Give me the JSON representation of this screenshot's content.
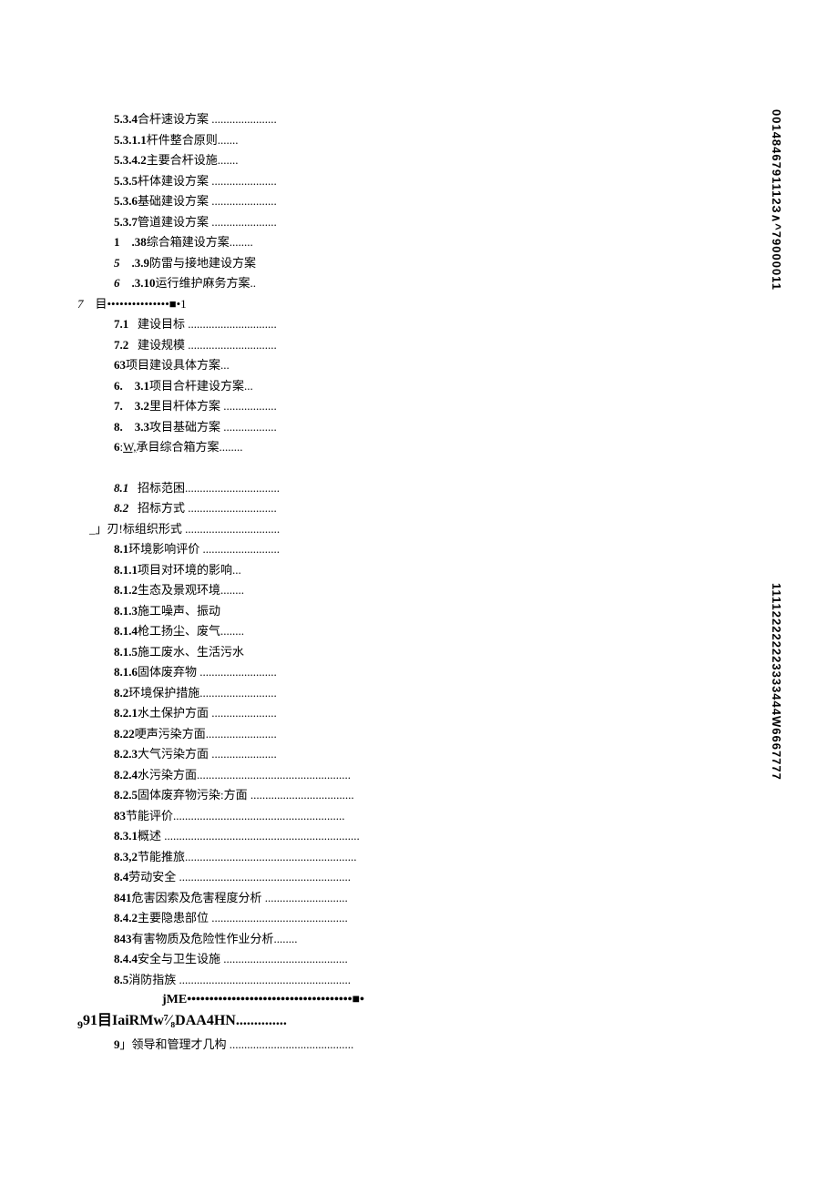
{
  "side": {
    "top": "0014846791112З∧^79000011",
    "bottom": "111122222223333444W6667777"
  },
  "lines": [
    {
      "cls": "indent1",
      "html": "<span class='bold-num'>5.3.4</span>合杆速设方案 ......................"
    },
    {
      "cls": "indent1",
      "html": "<span class='bold-num'>5.3.1.1</span>杆件整合原则......."
    },
    {
      "cls": "indent1",
      "html": "<span class='bold-num'>5.3.4.2</span>主要合杆设施......."
    },
    {
      "cls": "indent1",
      "html": "<span class='bold-num'>5.3.5</span>杆体建设方案 ......................"
    },
    {
      "cls": "indent1",
      "html": "<span class='bold-num'>5.3.6</span>基础建设方案 ......................"
    },
    {
      "cls": "indent1",
      "html": "<span class='bold-num'>5.3.7</span>管道建设方案 ......................"
    },
    {
      "cls": "indent1",
      "html": "<span class='bold-num'>1&nbsp;&nbsp;&nbsp;&nbsp;.38</span>综合箱建设方案........"
    },
    {
      "cls": "indent1",
      "html": "<span class='ital bold-num'>5&nbsp;&nbsp;&nbsp;&nbsp;</span><span class='bold-num'>.3.9</span>防雷与接地建设方案"
    },
    {
      "cls": "indent1",
      "html": "<span class='ital bold-num'>6&nbsp;&nbsp;&nbsp;&nbsp;</span><span class='bold-num'>.3.10</span>运行维护麻务方案.."
    },
    {
      "cls": "lvl7",
      "html": "<span class='ital'>7</span>&nbsp;&nbsp;&nbsp;&nbsp;目•••••••••••••••■•1"
    },
    {
      "cls": "indent1",
      "html": "<span class='bold-num'>7.1</span>&nbsp;&nbsp;&nbsp;建设目标 .............................."
    },
    {
      "cls": "indent1",
      "html": "<span class='bold-num'>7.2</span>&nbsp;&nbsp;&nbsp;建设规模 .............................."
    },
    {
      "cls": "indent1",
      "html": "<span class='bold-num'>63</span>项目建设具体方案..."
    },
    {
      "cls": "indent1",
      "html": "<span class='bold-num'>6.&nbsp;&nbsp;&nbsp;&nbsp;3.1</span>项目合杆建设方案..."
    },
    {
      "cls": "indent1",
      "html": "<span class='bold-num'>7.&nbsp;&nbsp;&nbsp;&nbsp;3.2</span>里目杆体方案 .................."
    },
    {
      "cls": "indent1",
      "html": "<span class='bold-num'>8.&nbsp;&nbsp;&nbsp;&nbsp;3.3</span>攻目基础方案 .................."
    },
    {
      "cls": "indent1",
      "html": "<span class='bold-num'>6</span>:<span class='underline'>W,</span>承目综合箱方案........"
    },
    {
      "cls": "gap",
      "html": ""
    },
    {
      "cls": "indent1",
      "html": "<span class='ital bold-num'>8.1</span>&nbsp;&nbsp;&nbsp;招标范困................................"
    },
    {
      "cls": "indent1",
      "html": "<span class='ital bold-num'>8.2</span>&nbsp;&nbsp;&nbsp;招标方式 .............................."
    },
    {
      "cls": "indent0",
      "html": "<span style='position:relative'>&nbsp;&nbsp;&nbsp;&nbsp;_」刃!标组织形式 ................................<span class='sec8' style='top:16px;left:0'>8</span></span>"
    },
    {
      "cls": "indent1",
      "html": "<span class='bold-num'>8.1</span>环境影响评价 .........................."
    },
    {
      "cls": "indent1",
      "html": "<span class='bold-num'>8.1.1</span>项目对环境的影响..."
    },
    {
      "cls": "indent1",
      "html": "<span class='bold-num'>8.1.2</span>生态及景观环境........"
    },
    {
      "cls": "indent1",
      "html": "<span class='bold-num'>8.1.3</span>施工噪声、振动"
    },
    {
      "cls": "indent1",
      "html": "<span class='bold-num'>8.1.4</span>枪工扬尘、废气........"
    },
    {
      "cls": "indent1",
      "html": "<span class='bold-num'>8.1.5</span>施工废水、生活污水"
    },
    {
      "cls": "indent1",
      "html": "<span class='bold-num'>8.1.6</span>固体废弃物 .........................."
    },
    {
      "cls": "indent1",
      "html": "<span class='bold-num'>8.2</span>环境保护措施.........................."
    },
    {
      "cls": "indent1",
      "html": "<span class='bold-num'>8.2.1</span>水土保护方面 ......................"
    },
    {
      "cls": "indent1",
      "html": "<span class='bold-num'>8.22</span>哽声污染方面........................"
    },
    {
      "cls": "indent1",
      "html": "<span class='bold-num'>8.2.3</span>大气污染方面 ......................"
    },
    {
      "cls": "indent1",
      "html": "<span class='bold-num'>8.2.4</span>水污染方面...................................................."
    },
    {
      "cls": "indent1",
      "html": "<span class='bold-num'>8.2.5</span>固体废弃物污染:方面 ..................................."
    },
    {
      "cls": "indent1",
      "html": "<span class='bold-num'>83</span>节能评价.........................................................."
    },
    {
      "cls": "indent1",
      "html": "<span class='bold-num'>8.3.1</span>概述 .................................................................."
    },
    {
      "cls": "indent1",
      "html": "<span class='bold-num'>8.3,2</span>节能推旅.........................................................."
    },
    {
      "cls": "indent1",
      "html": "<span class='bold-num'>8.4</span>劳动安全 .........................................................."
    },
    {
      "cls": "indent1",
      "html": "<span class='bold-num'>841</span>危害因索及危害程度分析 ............................"
    },
    {
      "cls": "indent1",
      "html": "<span class='bold-num'>8.4.2</span>主要隐患部位 .............................................."
    },
    {
      "cls": "indent1",
      "html": "<span class='bold-num'>843</span>有害物质及危险性作业分析........"
    },
    {
      "cls": "indent1",
      "html": "<span class='bold-num'>8.4.4</span>安全与卫生设施 .........................................."
    },
    {
      "cls": "indent1",
      "html": "<span class='bold-num'>8.5</span>消防指族 .........................................................."
    },
    {
      "cls": "jme-line",
      "html": "jME•••••••••••••••••••••••••••••••••••••■•"
    },
    {
      "cls": "indent0 big9",
      "html": "<sub style='font-size:12px'>9</sub>91⽬IaiRMw⁷⁄₈DAA4HN.............."
    },
    {
      "cls": "indent1",
      "html": "<span class='bold-num'>9</span>」领导和管理才几构 .........................................."
    }
  ]
}
